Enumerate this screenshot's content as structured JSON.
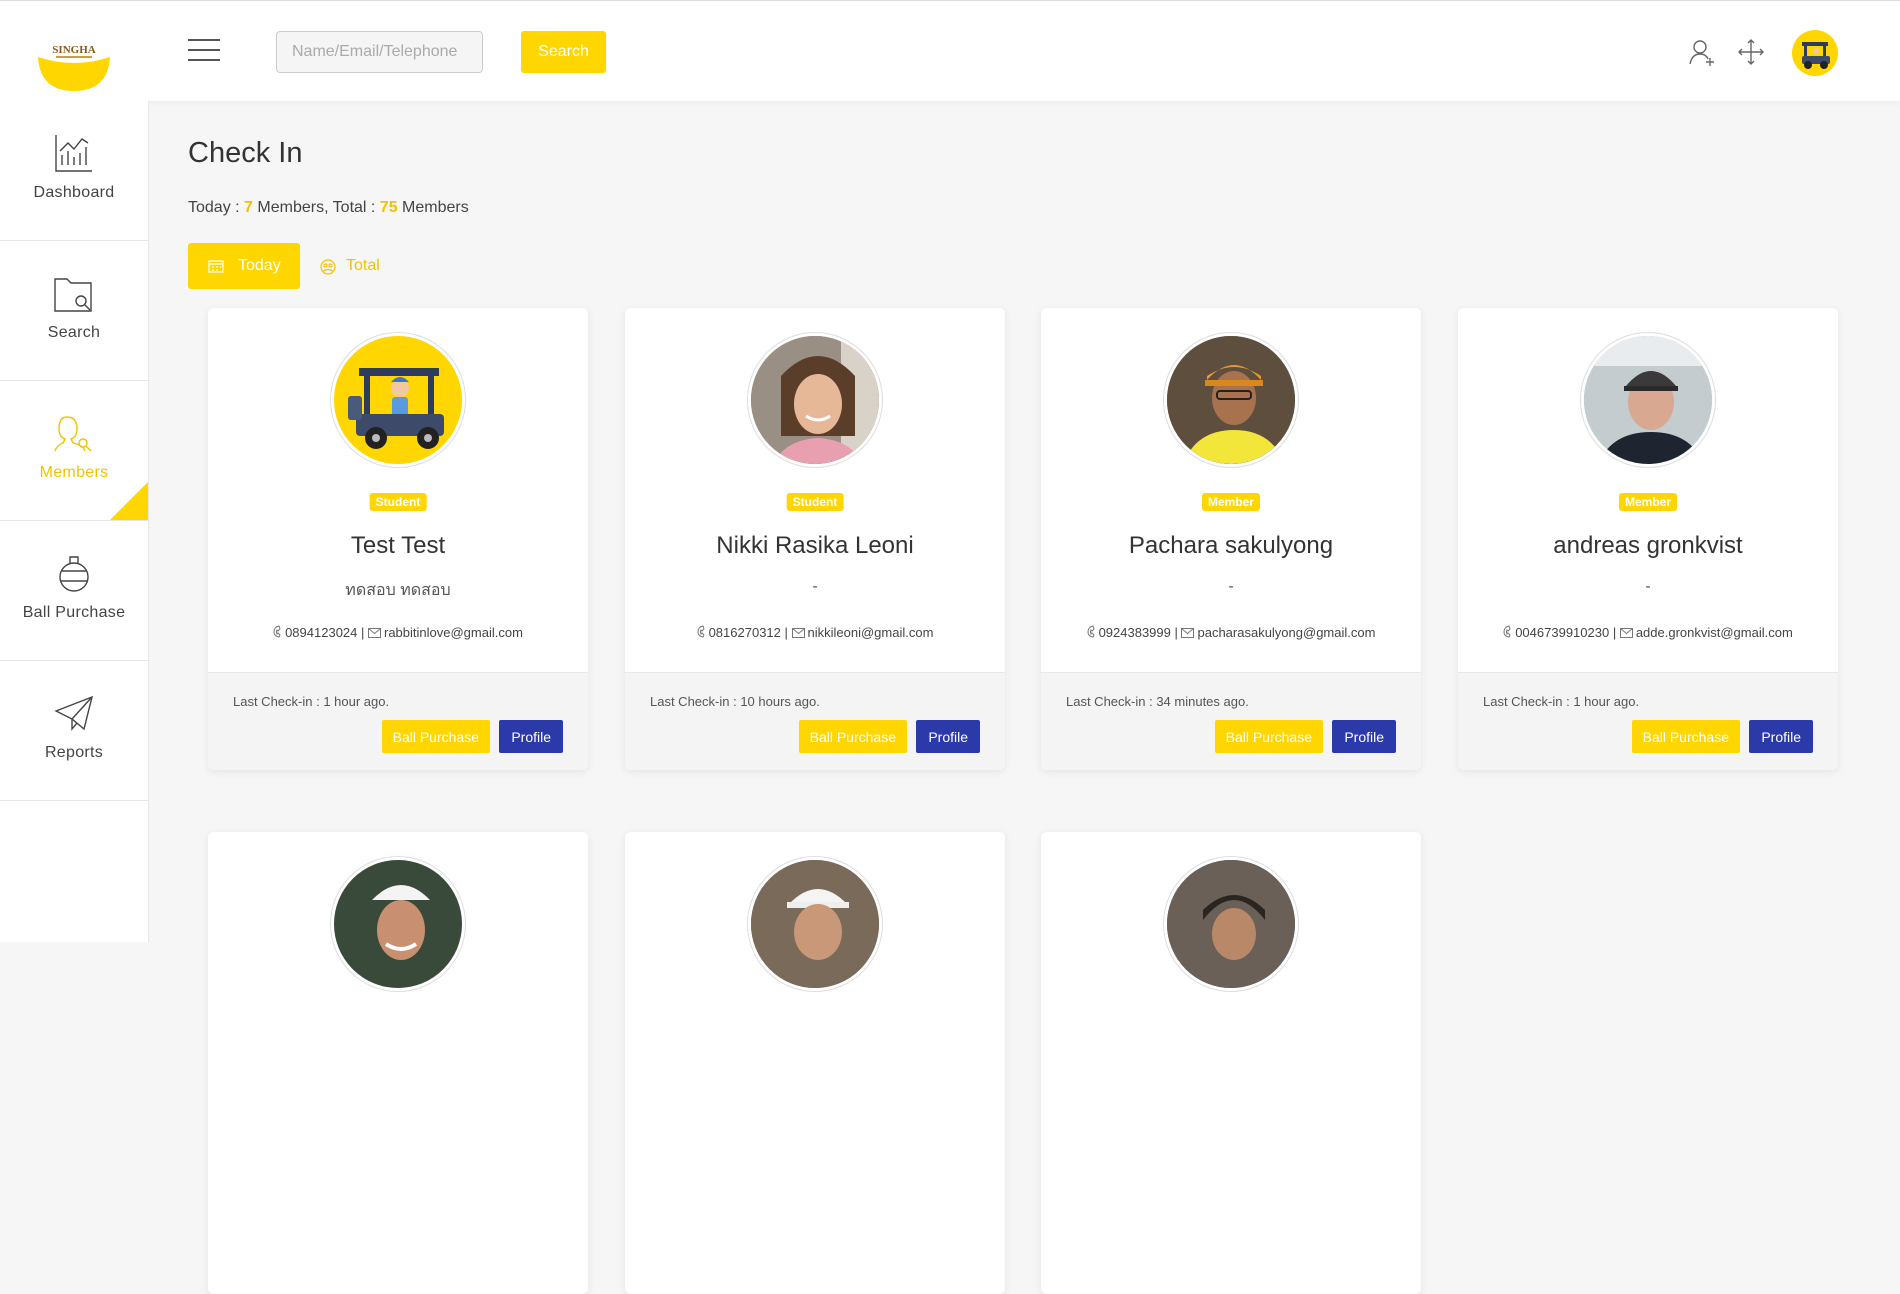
{
  "header": {
    "logo_text": "SINGHA",
    "search_placeholder": "Name/Email/Telephone",
    "search_label": "Search"
  },
  "sidebar": {
    "items": [
      {
        "label": "Dashboard",
        "icon": "chart-icon"
      },
      {
        "label": "Search",
        "icon": "folder-search-icon"
      },
      {
        "label": "Members",
        "icon": "member-search-icon",
        "active": true
      },
      {
        "label": "Ball Purchase",
        "icon": "ball-icon"
      },
      {
        "label": "Reports",
        "icon": "paper-plane-icon"
      }
    ]
  },
  "main": {
    "title": "Check In",
    "summary": {
      "today_prefix": "Today : ",
      "today_count": "7",
      "middle": " Members, Total : ",
      "total_count": "75",
      "suffix": " Members"
    },
    "tabs": {
      "today": "Today",
      "total": "Total"
    }
  },
  "cards": [
    {
      "badge": "Student",
      "name": "Test Test",
      "thai": "ทดสอบ ทดสอบ",
      "phone": "0894123024",
      "email": "rabbitinlove@gmail.com",
      "checkin": "Last Check-in : 1 hour ago.",
      "ball_label": "Ball Purchase",
      "profile_label": "Profile"
    },
    {
      "badge": "Student",
      "name": "Nikki Rasika Leoni",
      "thai": "-",
      "phone": "0816270312",
      "email": "nikkileoni@gmail.com",
      "checkin": "Last Check-in : 10 hours ago.",
      "ball_label": "Ball Purchase",
      "profile_label": "Profile"
    },
    {
      "badge": "Member",
      "name": "Pachara sakulyong",
      "thai": "-",
      "phone": "0924383999",
      "email": "pacharasakulyong@gmail.com",
      "checkin": "Last Check-in : 34 minutes ago.",
      "ball_label": "Ball Purchase",
      "profile_label": "Profile"
    },
    {
      "badge": "Member",
      "name": "andreas gronkvist",
      "thai": "-",
      "phone": "0046739910230",
      "email": "adde.gronkvist@gmail.com",
      "checkin": "Last Check-in : 1 hour ago.",
      "ball_label": "Ball Purchase",
      "profile_label": "Profile"
    }
  ],
  "colors": {
    "accent": "#ffd600",
    "profile_button": "#2b3aa8",
    "active_text": "#f2c200"
  }
}
